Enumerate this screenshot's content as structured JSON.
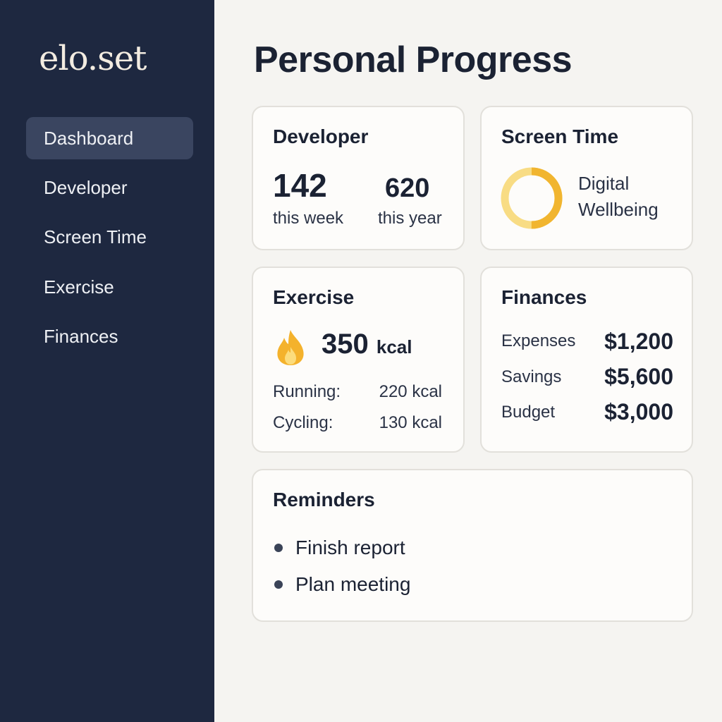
{
  "app": {
    "logo": "elo.set"
  },
  "sidebar": {
    "items": [
      {
        "label": "Dashboard",
        "active": true
      },
      {
        "label": "Developer",
        "active": false
      },
      {
        "label": "Screen Time",
        "active": false
      },
      {
        "label": "Exercise",
        "active": false
      },
      {
        "label": "Finances",
        "active": false
      }
    ]
  },
  "main": {
    "title": "Personal Progress",
    "developer": {
      "title": "Developer",
      "week_value": "142",
      "week_label": "this week",
      "year_value": "620",
      "year_label": "this year"
    },
    "screen_time": {
      "title": "Screen Time",
      "label_line1": "Digital",
      "label_line2": "Wellbeing",
      "ring_fill": 0.5,
      "ring_color": "#f1b52f",
      "ring_track_color": "#f8dc84"
    },
    "exercise": {
      "title": "Exercise",
      "icon": "flame-icon",
      "total_value": "350",
      "total_unit": "kcal",
      "rows": [
        {
          "label": "Running:",
          "value": "220 kcal"
        },
        {
          "label": "Cycling:",
          "value": "130 kcal"
        }
      ]
    },
    "finances": {
      "title": "Finances",
      "rows": [
        {
          "label": "Expenses",
          "value": "$1,200"
        },
        {
          "label": "Savings",
          "value": "$5,600"
        },
        {
          "label": "Budget",
          "value": "$3,000"
        }
      ]
    },
    "reminders": {
      "title": "Reminders",
      "items": [
        "Finish report",
        "Plan meeting"
      ]
    }
  },
  "colors": {
    "sidebar_bg": "#1e2840",
    "active_item_bg": "#3a4560",
    "page_bg": "#f5f4f1",
    "card_bg": "#fdfcfa",
    "accent": "#f1b52f"
  }
}
